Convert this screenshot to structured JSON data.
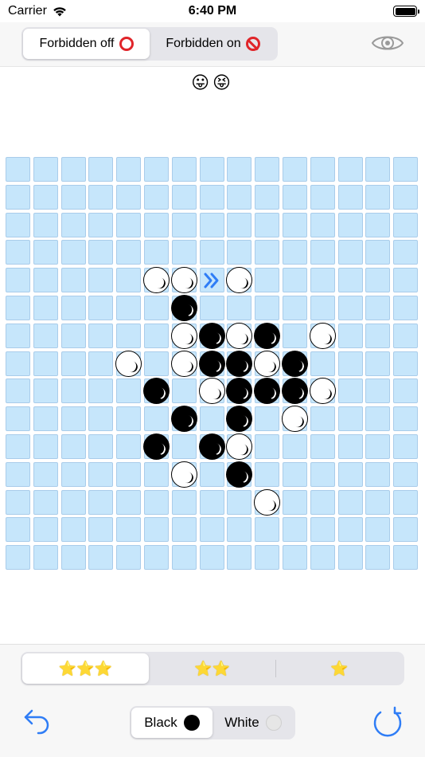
{
  "status_bar": {
    "carrier": "Carrier",
    "time": "6:40 PM"
  },
  "forbidden_toggle": {
    "options": [
      {
        "label": "Forbidden off",
        "icon": "red-circle-icon",
        "selected": true
      },
      {
        "label": "Forbidden on",
        "icon": "no-entry-icon",
        "selected": false
      }
    ]
  },
  "visibility_icon": "eye-icon",
  "emojis": "😛😝",
  "board": {
    "size": 15,
    "stones": [
      {
        "row": 4,
        "col": 5,
        "color": "white"
      },
      {
        "row": 4,
        "col": 6,
        "color": "white"
      },
      {
        "row": 4,
        "col": 8,
        "color": "white"
      },
      {
        "row": 5,
        "col": 6,
        "color": "black"
      },
      {
        "row": 6,
        "col": 6,
        "color": "white"
      },
      {
        "row": 6,
        "col": 7,
        "color": "black"
      },
      {
        "row": 6,
        "col": 8,
        "color": "white"
      },
      {
        "row": 6,
        "col": 9,
        "color": "black"
      },
      {
        "row": 6,
        "col": 11,
        "color": "white"
      },
      {
        "row": 7,
        "col": 4,
        "color": "white"
      },
      {
        "row": 7,
        "col": 6,
        "color": "white"
      },
      {
        "row": 7,
        "col": 7,
        "color": "black"
      },
      {
        "row": 7,
        "col": 8,
        "color": "black"
      },
      {
        "row": 7,
        "col": 9,
        "color": "white"
      },
      {
        "row": 7,
        "col": 10,
        "color": "black"
      },
      {
        "row": 8,
        "col": 5,
        "color": "black"
      },
      {
        "row": 8,
        "col": 7,
        "color": "white"
      },
      {
        "row": 8,
        "col": 8,
        "color": "black"
      },
      {
        "row": 8,
        "col": 9,
        "color": "black"
      },
      {
        "row": 8,
        "col": 10,
        "color": "black"
      },
      {
        "row": 8,
        "col": 11,
        "color": "white"
      },
      {
        "row": 9,
        "col": 6,
        "color": "black"
      },
      {
        "row": 9,
        "col": 8,
        "color": "black"
      },
      {
        "row": 9,
        "col": 10,
        "color": "white"
      },
      {
        "row": 10,
        "col": 5,
        "color": "black"
      },
      {
        "row": 10,
        "col": 7,
        "color": "black"
      },
      {
        "row": 10,
        "col": 8,
        "color": "white"
      },
      {
        "row": 11,
        "col": 6,
        "color": "white"
      },
      {
        "row": 11,
        "col": 8,
        "color": "black"
      },
      {
        "row": 12,
        "col": 9,
        "color": "white"
      }
    ],
    "hint_marker": {
      "row": 4,
      "col": 7,
      "icon": "double-chevron-right-icon",
      "color": "#2f7df6"
    }
  },
  "difficulty": {
    "options": [
      {
        "label": "⭐⭐⭐",
        "selected": true
      },
      {
        "label": "⭐⭐",
        "selected": false
      },
      {
        "label": "⭐",
        "selected": false
      }
    ]
  },
  "player_color": {
    "options": [
      {
        "label": "Black",
        "stone": "black",
        "selected": true
      },
      {
        "label": "White",
        "stone": "white",
        "selected": false
      }
    ]
  },
  "colors": {
    "accent": "#2f7df6",
    "cell_fill": "#c6e6fb",
    "cell_border": "#a9ccea",
    "forbid_red": "#e0252a"
  }
}
